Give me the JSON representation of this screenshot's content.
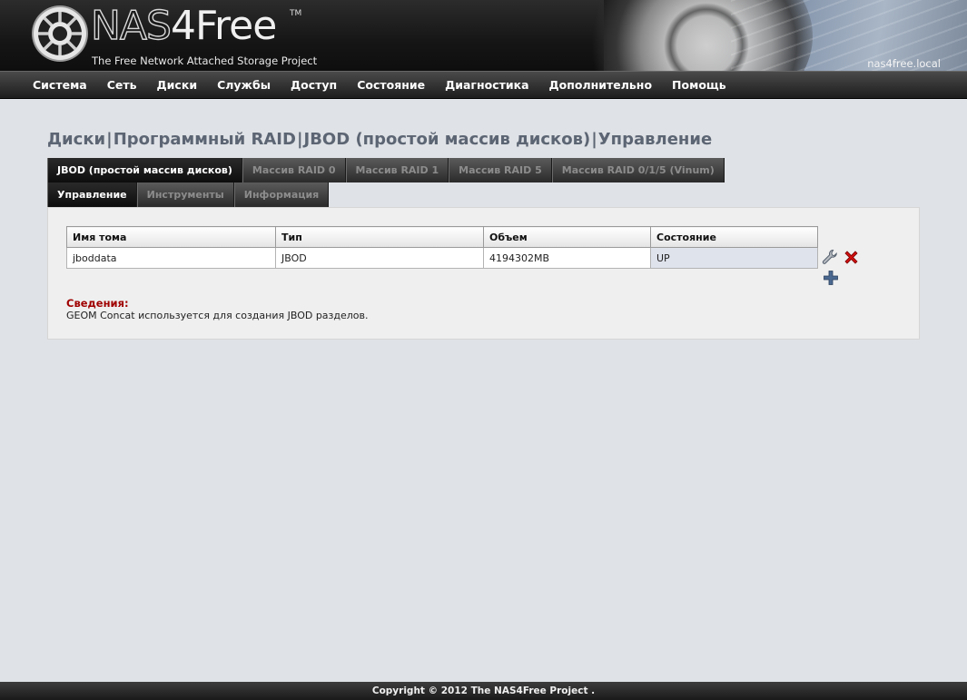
{
  "header": {
    "logo_nas": "NAS",
    "logo_free": "4Free",
    "logo_tm": "TM",
    "tagline": "The Free Network Attached Storage Project",
    "hostname": "nas4free.local"
  },
  "nav": {
    "items": [
      {
        "label": "Система"
      },
      {
        "label": "Сеть"
      },
      {
        "label": "Диски"
      },
      {
        "label": "Службы"
      },
      {
        "label": "Доступ"
      },
      {
        "label": "Состояние"
      },
      {
        "label": "Диагностика"
      },
      {
        "label": "Дополнительно"
      },
      {
        "label": "Помощь"
      }
    ]
  },
  "breadcrumb": {
    "parts": [
      "Диски",
      "Программный RAID",
      "JBOD (простой массив дисков)",
      "Управление"
    ],
    "separator": "|"
  },
  "tabs_primary": [
    {
      "label": "JBOD (простой массив дисков)",
      "active": true
    },
    {
      "label": "Массив RAID 0",
      "active": false
    },
    {
      "label": "Массив RAID 1",
      "active": false
    },
    {
      "label": "Массив RAID 5",
      "active": false
    },
    {
      "label": "Массив RAID 0/1/5 (Vinum)",
      "active": false
    }
  ],
  "tabs_secondary": [
    {
      "label": "Управление",
      "active": true
    },
    {
      "label": "Инструменты",
      "active": false
    },
    {
      "label": "Информация",
      "active": false
    }
  ],
  "table": {
    "headers": [
      "Имя тома",
      "Тип",
      "Объем",
      "Состояние"
    ],
    "rows": [
      {
        "name": "jboddata",
        "type": "JBOD",
        "size": "4194302MB",
        "state": "UP"
      }
    ]
  },
  "icons": {
    "edit": "wrench-icon",
    "delete": "red-x-icon",
    "add": "plus-icon"
  },
  "info": {
    "title": "Сведения:",
    "text": "GEOM Concat используется для создания JBOD разделов."
  },
  "footer": {
    "copyright": "Copyright © 2012 The NAS4Free Project ."
  },
  "colors": {
    "page_bg": "#dfe2e6",
    "title": "#5c6573",
    "info_title": "#a00000",
    "delete_icon": "#d01010",
    "add_icon": "#4a6890"
  }
}
